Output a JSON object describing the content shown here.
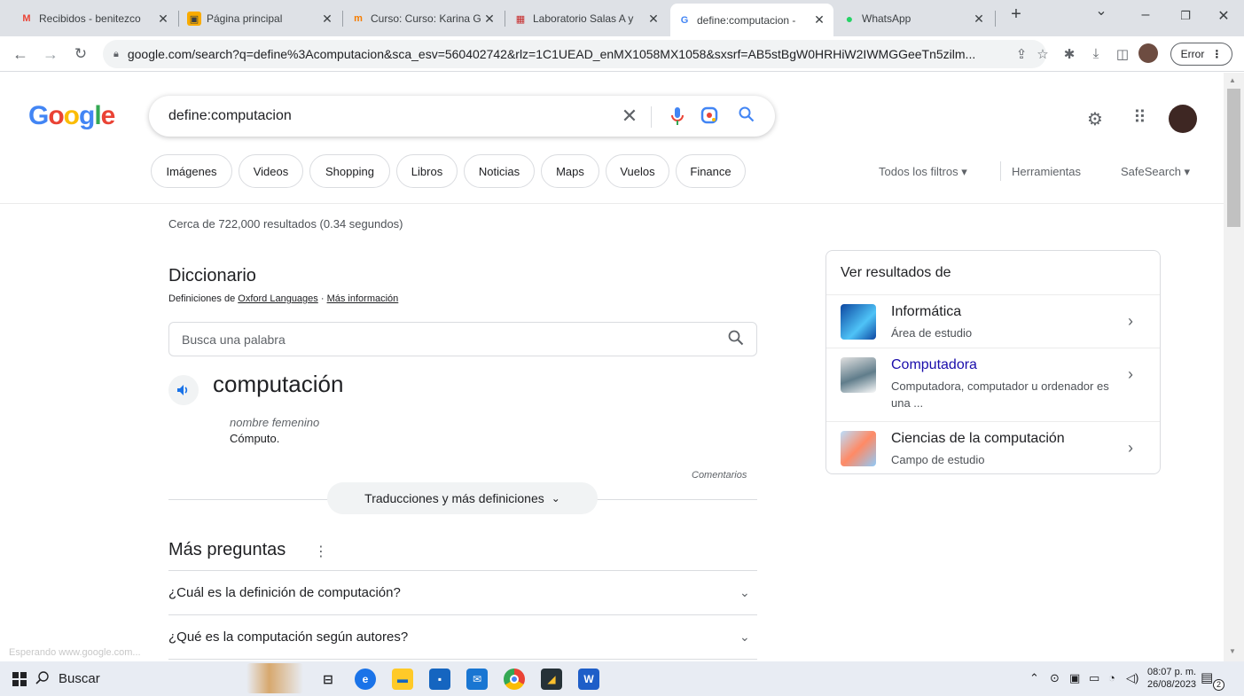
{
  "tabs": [
    {
      "title": "Recibidos - benitezco",
      "favicon": "M",
      "favicon_color": "#ea4335"
    },
    {
      "title": "Página principal",
      "favicon": "▣",
      "favicon_color": "#f9ab00"
    },
    {
      "title": "Curso: Curso: Karina G",
      "favicon": "m",
      "favicon_color": "#f57c00"
    },
    {
      "title": "Laboratorio Salas A y",
      "favicon": "▦",
      "favicon_color": "#c62828"
    },
    {
      "title": "define:computacion -",
      "favicon": "G",
      "favicon_color": "#4285f4"
    },
    {
      "title": "WhatsApp",
      "favicon": "●",
      "favicon_color": "#25d366"
    }
  ],
  "window": {
    "new_tab": "+",
    "dropdown": "⌄",
    "minimize": "–",
    "maximize": "❐",
    "close": "✕"
  },
  "address": {
    "url": "google.com/search?q=define%3Acomputacion&sca_esv=560402742&rlz=1C1UEAD_enMX1058MX1058&sxsrf=AB5stBgW0HRHiW2IWMGGeeTn5zilm...",
    "error_label": "Error"
  },
  "search": {
    "logo": "Google",
    "query": "define:computacion"
  },
  "chips": [
    "Imágenes",
    "Videos",
    "Shopping",
    "Libros",
    "Noticias",
    "Maps",
    "Vuelos",
    "Finance"
  ],
  "filters": {
    "all_filters": "Todos los filtros ▾",
    "tools": "Herramientas",
    "safesearch": "SafeSearch ▾"
  },
  "stats": "Cerca de 722,000 resultados (0.34 segundos)",
  "dictionary": {
    "title": "Diccionario",
    "source_prefix": "Definiciones de ",
    "source_link": "Oxford Languages",
    "source_sep": " · ",
    "more_info": "Más información",
    "search_placeholder": "Busca una palabra",
    "word": "computación",
    "part_of_speech": "nombre femenino",
    "definition": "Cómputo.",
    "comments": "Comentarios",
    "translations": "Traducciones y más definiciones"
  },
  "more_questions": {
    "title": "Más preguntas",
    "items": [
      "¿Cuál es la definición de computación?",
      "¿Qué es la computación según autores?"
    ]
  },
  "panel": {
    "title": "Ver resultados de",
    "items": [
      {
        "title": "Informática",
        "subtitle": "Área de estudio"
      },
      {
        "title": "Computadora",
        "subtitle": "Computadora, computador u ordenador es una ..."
      },
      {
        "title": "Ciencias de la computación",
        "subtitle": "Campo de estudio"
      }
    ]
  },
  "status_text": "Esperando www.google.com...",
  "taskbar": {
    "search_label": "Buscar",
    "time": "08:07 p. m.",
    "date": "26/08/2023",
    "notifications": "2"
  }
}
